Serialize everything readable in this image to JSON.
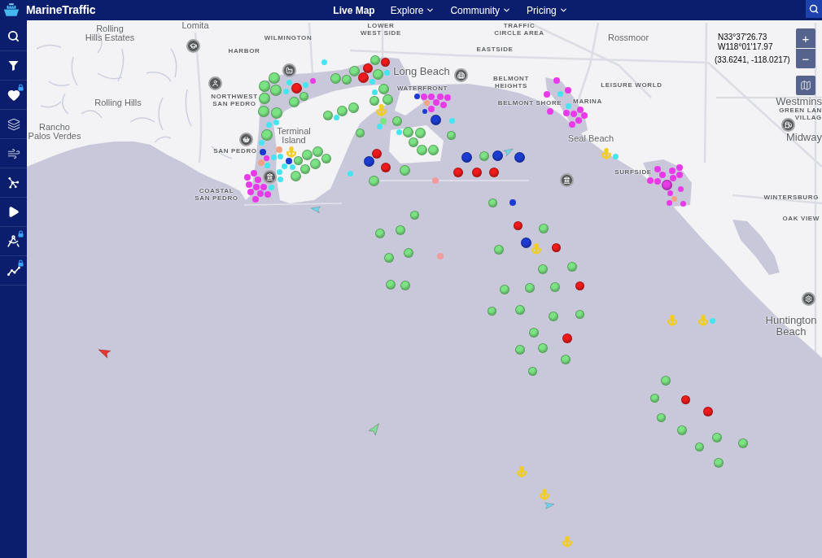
{
  "header": {
    "logo": "MarineTraffic",
    "nav": [
      {
        "label": "Live Map",
        "selected": true,
        "dropdown": false
      },
      {
        "label": "Explore",
        "selected": false,
        "dropdown": true
      },
      {
        "label": "Community",
        "selected": false,
        "dropdown": true
      },
      {
        "label": "Pricing",
        "selected": false,
        "dropdown": true
      }
    ]
  },
  "sidebar": {
    "items": [
      {
        "locked": false
      },
      {
        "locked": false
      },
      {
        "locked": true
      },
      {
        "locked": false
      },
      {
        "locked": false
      },
      {
        "locked": false
      },
      {
        "locked": false
      },
      {
        "locked": true
      },
      {
        "locked": true
      }
    ]
  },
  "map": {
    "places": [
      {
        "kind": "town",
        "lines": [
          "Rolling",
          "Hills Estates"
        ]
      },
      {
        "kind": "town",
        "lines": [
          "Lomita"
        ]
      },
      {
        "kind": "district",
        "lines": [
          "WILMINGTON"
        ]
      },
      {
        "kind": "district",
        "lines": [
          "LOWER",
          "WEST SIDE"
        ]
      },
      {
        "kind": "district",
        "lines": [
          "TRAFFIC",
          "CIRCLE AREA"
        ]
      },
      {
        "kind": "town",
        "lines": [
          "Rossmoor"
        ]
      },
      {
        "kind": "district",
        "lines": [
          "HARBOR"
        ]
      },
      {
        "kind": "district",
        "lines": [
          "EASTSIDE"
        ]
      },
      {
        "kind": "city",
        "lines": [
          "Long Beach"
        ]
      },
      {
        "kind": "district",
        "lines": [
          "WATERFRONT"
        ]
      },
      {
        "kind": "district",
        "lines": [
          "BELMONT",
          "HEIGHTS"
        ]
      },
      {
        "kind": "district",
        "lines": [
          "LEISURE WORLD"
        ]
      },
      {
        "kind": "town",
        "lines": [
          "Rolling Hills"
        ]
      },
      {
        "kind": "district",
        "lines": [
          "NORTHWEST",
          "SAN PEDRO"
        ]
      },
      {
        "kind": "district",
        "lines": [
          "BELMONT SHORE"
        ]
      },
      {
        "kind": "district",
        "lines": [
          "MARINA"
        ]
      },
      {
        "kind": "city",
        "lines": [
          "Westmins"
        ]
      },
      {
        "kind": "district",
        "lines": [
          "GREEN LAN",
          "VILLAG"
        ]
      },
      {
        "kind": "town",
        "lines": [
          "Rancho",
          "Palos Verdes"
        ]
      },
      {
        "kind": "town",
        "lines": [
          "Terminal",
          "Island"
        ]
      },
      {
        "kind": "town",
        "lines": [
          "Seal Beach"
        ]
      },
      {
        "kind": "city",
        "lines": [
          "Midway"
        ]
      },
      {
        "kind": "district",
        "lines": [
          "SAN PEDRO"
        ]
      },
      {
        "kind": "district",
        "lines": [
          "SURFSIDE"
        ]
      },
      {
        "kind": "district",
        "lines": [
          "COASTAL",
          "SAN PEDRO"
        ]
      },
      {
        "kind": "district",
        "lines": [
          "WINTERSBURG"
        ]
      },
      {
        "kind": "district",
        "lines": [
          "OAK VIEW"
        ]
      },
      {
        "kind": "city",
        "lines": [
          "Huntington",
          "Beach"
        ]
      }
    ],
    "coordinates": {
      "latitude": "N33°37'26.73",
      "longitude": "W118°01'17.97",
      "decimal": "(33.6241, -118.0217)"
    },
    "zoom": {
      "in": "+",
      "out": "−"
    },
    "vessels": [
      {
        "kind": "dot",
        "color": "#7be383"
      },
      {
        "kind": "dot",
        "color": "#7be383"
      },
      {
        "kind": "dot",
        "color": "#7be383"
      },
      {
        "kind": "dot",
        "color": "#7be383"
      },
      {
        "kind": "dot",
        "color": "#7be383"
      },
      {
        "kind": "dot",
        "color": "#7be383"
      },
      {
        "kind": "dot",
        "color": "#7be383"
      },
      {
        "kind": "dot",
        "color": "#7be383"
      },
      {
        "kind": "dot",
        "color": "#7be383"
      },
      {
        "kind": "dot",
        "color": "#7be383"
      },
      {
        "kind": "dot",
        "color": "#7be383"
      },
      {
        "kind": "dot",
        "color": "#7be383"
      },
      {
        "kind": "dot",
        "color": "#7be383"
      },
      {
        "kind": "dot",
        "color": "#7be383"
      },
      {
        "kind": "dot",
        "color": "#7be383"
      },
      {
        "kind": "dot",
        "color": "#7be383"
      },
      {
        "kind": "dot",
        "color": "#7be383"
      },
      {
        "kind": "dot",
        "color": "#7be383"
      },
      {
        "kind": "dot",
        "color": "#7be383"
      },
      {
        "kind": "dot",
        "color": "#7be383"
      },
      {
        "kind": "dot",
        "color": "#7be383"
      },
      {
        "kind": "dot",
        "color": "#7be383"
      },
      {
        "kind": "dot",
        "color": "#7be383"
      },
      {
        "kind": "dot",
        "color": "#7be383"
      },
      {
        "kind": "dot",
        "color": "#7be383"
      },
      {
        "kind": "dot",
        "color": "#7be383"
      },
      {
        "kind": "dot",
        "color": "#7be383"
      },
      {
        "kind": "dot",
        "color": "#7be383"
      },
      {
        "kind": "dot",
        "color": "#7be383"
      },
      {
        "kind": "dot",
        "color": "#7be383"
      },
      {
        "kind": "dot",
        "color": "#7be383"
      },
      {
        "kind": "dot",
        "color": "#7be383"
      },
      {
        "kind": "dot",
        "color": "#7be383"
      },
      {
        "kind": "dot",
        "color": "#7be383"
      },
      {
        "kind": "dot",
        "color": "#7be383"
      },
      {
        "kind": "dot",
        "color": "#7be383"
      },
      {
        "kind": "dot",
        "color": "#7be383"
      },
      {
        "kind": "dot",
        "color": "#7be383"
      },
      {
        "kind": "dot",
        "color": "#7be383"
      },
      {
        "kind": "dot",
        "color": "#7be383"
      },
      {
        "kind": "dot",
        "color": "#7be383"
      },
      {
        "kind": "dot",
        "color": "#7be383"
      },
      {
        "kind": "dot",
        "color": "#7be383"
      },
      {
        "kind": "dot",
        "color": "#7be383"
      },
      {
        "kind": "dot",
        "color": "#7be383"
      },
      {
        "kind": "dot",
        "color": "#7be383"
      },
      {
        "kind": "dot",
        "color": "#7be383"
      },
      {
        "kind": "dot",
        "color": "#7be383"
      },
      {
        "kind": "dot",
        "color": "#7be383"
      },
      {
        "kind": "dot",
        "color": "#7be383"
      },
      {
        "kind": "dot",
        "color": "#7be383"
      },
      {
        "kind": "dot",
        "color": "#7be383"
      },
      {
        "kind": "dot",
        "color": "#7be383"
      },
      {
        "kind": "dot",
        "color": "#7be383"
      },
      {
        "kind": "dot",
        "color": "#7be383"
      },
      {
        "kind": "dot",
        "color": "#7be383"
      },
      {
        "kind": "dot",
        "color": "#7be383"
      },
      {
        "kind": "dot",
        "color": "#7be383"
      },
      {
        "kind": "dot",
        "color": "#7be383"
      },
      {
        "kind": "dot",
        "color": "#7be383"
      },
      {
        "kind": "dot",
        "color": "#7be383"
      },
      {
        "kind": "dot",
        "color": "#7be383"
      },
      {
        "kind": "dot",
        "color": "#7be383"
      },
      {
        "kind": "dot",
        "color": "#7be383"
      },
      {
        "kind": "dot",
        "color": "#7be383"
      },
      {
        "kind": "dot",
        "color": "#7be383"
      },
      {
        "kind": "dot",
        "color": "#7be383"
      },
      {
        "kind": "dot",
        "color": "#7be383"
      },
      {
        "kind": "dot",
        "color": "#7be383"
      },
      {
        "kind": "dot",
        "color": "#7be383"
      },
      {
        "kind": "dot",
        "color": "#7be383"
      },
      {
        "kind": "dot",
        "color": "#ef1b1b"
      },
      {
        "kind": "dot",
        "color": "#ef1b1b"
      },
      {
        "kind": "dot",
        "color": "#ef1b1b"
      },
      {
        "kind": "dot",
        "color": "#ef1b1b"
      },
      {
        "kind": "dot",
        "color": "#ef1b1b"
      },
      {
        "kind": "dot",
        "color": "#ef1b1b"
      },
      {
        "kind": "dot",
        "color": "#ef1b1b"
      },
      {
        "kind": "dot",
        "color": "#ef1b1b"
      },
      {
        "kind": "dot",
        "color": "#ef1b1b"
      },
      {
        "kind": "dot",
        "color": "#ef1b1b"
      },
      {
        "kind": "dot",
        "color": "#ef1b1b"
      },
      {
        "kind": "dot",
        "color": "#ef1b1b"
      },
      {
        "kind": "dot",
        "color": "#ef1b1b"
      },
      {
        "kind": "dot",
        "color": "#ef1b1b"
      },
      {
        "kind": "dot",
        "color": "#ef1b1b"
      },
      {
        "kind": "dot",
        "color": "#1c3bd1"
      },
      {
        "kind": "dot",
        "color": "#1c3bd1"
      },
      {
        "kind": "dot",
        "color": "#1c3bd1"
      },
      {
        "kind": "dot",
        "color": "#1c3bd1"
      },
      {
        "kind": "dot",
        "color": "#1c3bd1"
      },
      {
        "kind": "dot",
        "color": "#1c3bd1"
      },
      {
        "kind": "dot",
        "color": "#1c3bd1"
      },
      {
        "kind": "dot",
        "color": "#1c3bd1"
      },
      {
        "kind": "dot",
        "color": "#1c3bd1"
      },
      {
        "kind": "dot",
        "color": "#1c3bd1"
      },
      {
        "kind": "dot",
        "color": "#1c3bd1"
      },
      {
        "kind": "dot",
        "color": "#45e5ef"
      },
      {
        "kind": "dot",
        "color": "#45e5ef"
      },
      {
        "kind": "dot",
        "color": "#45e5ef"
      },
      {
        "kind": "dot",
        "color": "#45e5ef"
      },
      {
        "kind": "dot",
        "color": "#45e5ef"
      },
      {
        "kind": "dot",
        "color": "#45e5ef"
      },
      {
        "kind": "dot",
        "color": "#45e5ef"
      },
      {
        "kind": "dot",
        "color": "#45e5ef"
      },
      {
        "kind": "dot",
        "color": "#45e5ef"
      },
      {
        "kind": "dot",
        "color": "#45e5ef"
      },
      {
        "kind": "dot",
        "color": "#45e5ef"
      },
      {
        "kind": "dot",
        "color": "#45e5ef"
      },
      {
        "kind": "dot",
        "color": "#45e5ef"
      },
      {
        "kind": "dot",
        "color": "#45e5ef"
      },
      {
        "kind": "dot",
        "color": "#45e5ef"
      },
      {
        "kind": "dot",
        "color": "#45e5ef"
      },
      {
        "kind": "dot",
        "color": "#45e5ef"
      },
      {
        "kind": "dot",
        "color": "#45e5ef"
      },
      {
        "kind": "dot",
        "color": "#45e5ef"
      },
      {
        "kind": "dot",
        "color": "#45e5ef"
      },
      {
        "kind": "dot",
        "color": "#45e5ef"
      },
      {
        "kind": "dot",
        "color": "#45e5ef"
      },
      {
        "kind": "dot",
        "color": "#45e5ef"
      },
      {
        "kind": "dot",
        "color": "#45e5ef"
      },
      {
        "kind": "dot",
        "color": "#45e5ef"
      },
      {
        "kind": "dot",
        "color": "#45e5ef"
      },
      {
        "kind": "dot",
        "color": "#45e5ef"
      },
      {
        "kind": "dot",
        "color": "#e93ae9"
      },
      {
        "kind": "dot",
        "color": "#e93ae9"
      },
      {
        "kind": "dot",
        "color": "#e93ae9"
      },
      {
        "kind": "dot",
        "color": "#e93ae9"
      },
      {
        "kind": "dot",
        "color": "#e93ae9"
      },
      {
        "kind": "dot",
        "color": "#e93ae9"
      },
      {
        "kind": "dot",
        "color": "#e93ae9"
      },
      {
        "kind": "dot",
        "color": "#e93ae9"
      },
      {
        "kind": "dot",
        "color": "#e93ae9"
      },
      {
        "kind": "dot",
        "color": "#e93ae9"
      },
      {
        "kind": "dot",
        "color": "#e93ae9"
      },
      {
        "kind": "dot",
        "color": "#e93ae9"
      },
      {
        "kind": "dot",
        "color": "#e93ae9"
      },
      {
        "kind": "dot",
        "color": "#e93ae9"
      },
      {
        "kind": "dot",
        "color": "#e93ae9"
      },
      {
        "kind": "dot",
        "color": "#e93ae9"
      },
      {
        "kind": "dot",
        "color": "#e93ae9"
      },
      {
        "kind": "dot",
        "color": "#e93ae9"
      },
      {
        "kind": "dot",
        "color": "#e93ae9"
      },
      {
        "kind": "dot",
        "color": "#e93ae9"
      },
      {
        "kind": "dot",
        "color": "#e93ae9"
      },
      {
        "kind": "dot",
        "color": "#e93ae9"
      },
      {
        "kind": "dot",
        "color": "#e93ae9"
      },
      {
        "kind": "dot",
        "color": "#e93ae9"
      },
      {
        "kind": "dot",
        "color": "#e93ae9"
      },
      {
        "kind": "dot",
        "color": "#e93ae9"
      },
      {
        "kind": "dot",
        "color": "#e93ae9"
      },
      {
        "kind": "dot",
        "color": "#e93ae9"
      },
      {
        "kind": "dot",
        "color": "#e93ae9"
      },
      {
        "kind": "dot",
        "color": "#e93ae9"
      },
      {
        "kind": "dot",
        "color": "#e93ae9"
      },
      {
        "kind": "dot",
        "color": "#e93ae9"
      },
      {
        "kind": "dot",
        "color": "#e93ae9"
      },
      {
        "kind": "dot",
        "color": "#e93ae9"
      },
      {
        "kind": "dot",
        "color": "#e93ae9"
      },
      {
        "kind": "dot",
        "color": "#e93ae9"
      },
      {
        "kind": "dot",
        "color": "#e93ae9"
      },
      {
        "kind": "dot",
        "color": "#e93ae9"
      },
      {
        "kind": "dot",
        "color": "#e93ae9"
      },
      {
        "kind": "dot",
        "color": "#e93ae9"
      },
      {
        "kind": "dot",
        "color": "#e93ae9"
      },
      {
        "kind": "dot",
        "color": "#e93ae9"
      },
      {
        "kind": "dot",
        "color": "#f3a282"
      },
      {
        "kind": "dot",
        "color": "#f3a282"
      },
      {
        "kind": "dot",
        "color": "#f3a282"
      },
      {
        "kind": "dot",
        "color": "#f3a282"
      },
      {
        "kind": "dot",
        "color": "#f19b9b"
      },
      {
        "kind": "dot",
        "color": "#f19b9b"
      },
      {
        "kind": "anchor",
        "color": "#f2cd1b"
      },
      {
        "kind": "anchor",
        "color": "#f2cd1b"
      },
      {
        "kind": "anchor",
        "color": "#f2cd1b"
      },
      {
        "kind": "anchor",
        "color": "#f2cd1b"
      },
      {
        "kind": "anchor",
        "color": "#f2cd1b"
      },
      {
        "kind": "anchor",
        "color": "#f2cd1b"
      },
      {
        "kind": "anchor",
        "color": "#f2cd1b"
      },
      {
        "kind": "anchor",
        "color": "#f2cd1b"
      },
      {
        "kind": "anchor",
        "color": "#f2cd1b"
      },
      {
        "kind": "ship",
        "color": "#e8352e"
      },
      {
        "kind": "ship",
        "color": "#82dc97"
      },
      {
        "kind": "ship",
        "color": "#6dd6e6"
      },
      {
        "kind": "ship",
        "color": "#6dd6e6"
      },
      {
        "kind": "ship",
        "color": "#6dd6e6"
      }
    ]
  }
}
